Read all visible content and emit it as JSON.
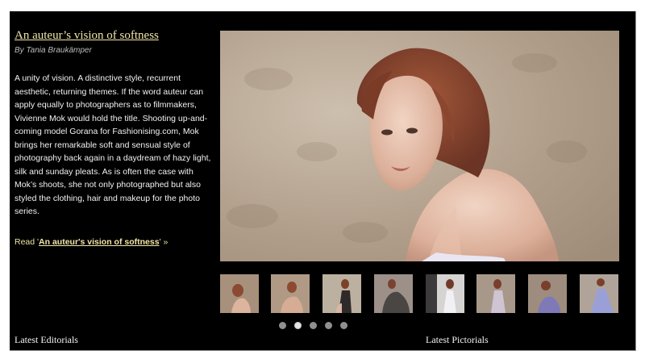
{
  "article": {
    "title": "An auteur’s vision of softness",
    "byline": "By Tania Braukämper",
    "body": "A unity of vision. A distinctive style, recurrent aesthetic, returning themes. If the word auteur can apply equally to photographers as to filmmakers, Vivienne Mok would hold the title. Shooting up-and-coming model Gorana for Fashionising.com, Mok brings her remarkable soft and sensual style of photography back again in a daydream of hazy light, silk and sunday pleats. As is often the case with Mok’s shoots, she not only photographed but also styled the clothing, hair and makeup for the photo series.",
    "read_prefix": "Read '",
    "read_link": "An auteur's vision of softness",
    "read_suffix": "' »"
  },
  "carousel": {
    "active_dot": 2,
    "dot_count": 5
  },
  "sections": {
    "editorials": "Latest Editorials",
    "pictorials": "Latest Pictorials"
  }
}
